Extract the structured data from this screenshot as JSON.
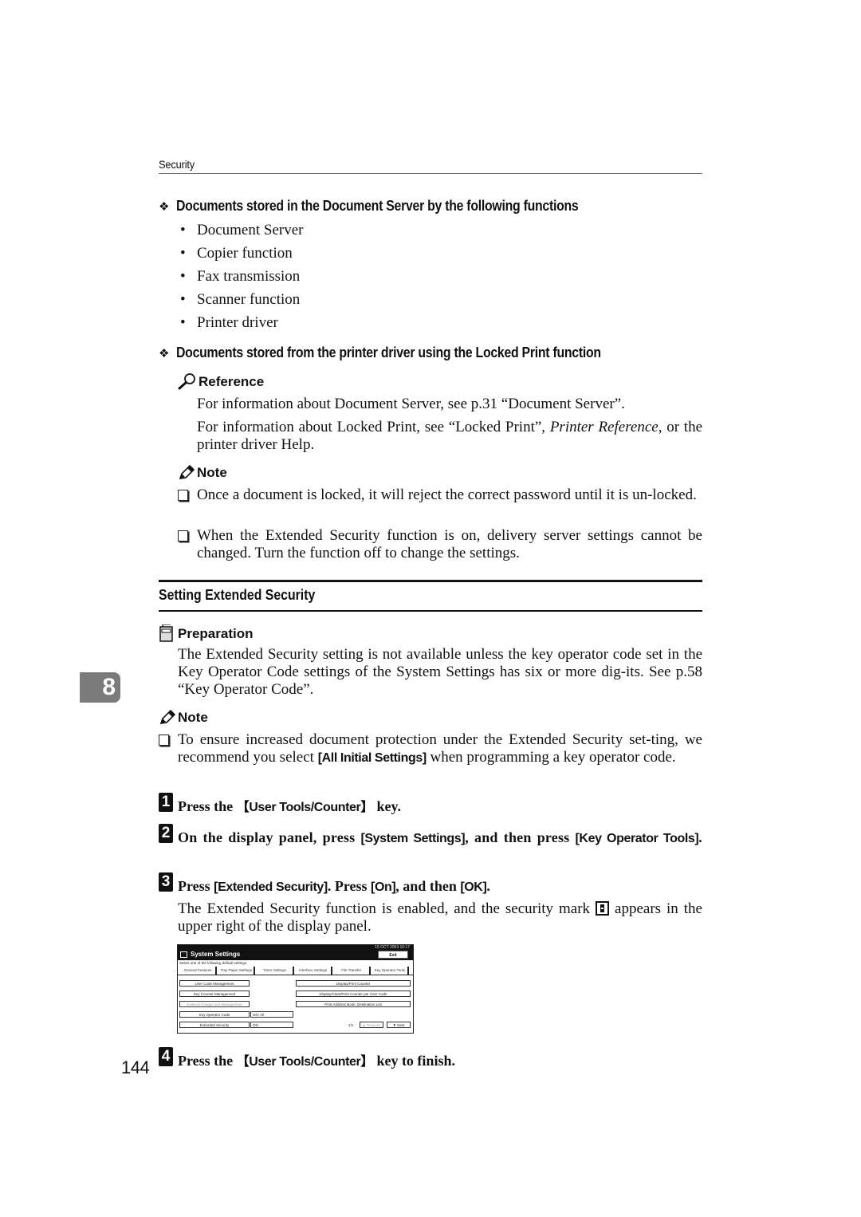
{
  "running_head": "Security",
  "section_a": {
    "heading": "Documents stored in the Document Server by the following functions",
    "items": [
      "Document Server",
      "Copier function",
      "Fax transmission",
      "Scanner function",
      "Printer driver"
    ]
  },
  "section_b": {
    "heading": "Documents stored from the printer driver using the Locked Print function"
  },
  "reference": {
    "title": "Reference",
    "line1": "For information about Document Server, see p.31 “Document Server”.",
    "line2_pre": "For information about Locked Print, see “Locked Print”, ",
    "line2_ital": "Printer Reference",
    "line2_post": ", or the printer driver Help."
  },
  "note1": {
    "title": "Note",
    "items": [
      "Once a document is locked, it will reject the correct password until it is un-locked.",
      "When the Extended Security function is on, delivery server settings cannot be changed. Turn the function off to change the settings."
    ]
  },
  "section_title": "Setting Extended Security",
  "chapter_tab": "8",
  "preparation": {
    "title": "Preparation",
    "text": "The Extended Security setting is not available unless the key operator code set in the Key Operator Code settings of the System Settings has six or more dig-its. See p.58 “Key Operator Code”."
  },
  "note2": {
    "title": "Note",
    "pre": "To ensure increased document protection under the Extended Security set-ting, we recommend you select ",
    "key": "[All Initial Settings]",
    "post": " when programming a key operator code."
  },
  "steps": [
    {
      "num": "1",
      "pre": "Press the ",
      "key": "【User Tools/Counter】",
      "post": " key."
    },
    {
      "num": "2",
      "pre": "On the display panel, press ",
      "key": "[System Settings]",
      "mid": ", and then press ",
      "key2": "[Key Operator Tools]",
      "post": "."
    },
    {
      "num": "3",
      "pre": "Press ",
      "key": "[Extended Security]",
      "mid": ". Press ",
      "key2": "[On]",
      "mid2": ", and then ",
      "key3": "[OK]",
      "post": "."
    },
    {
      "num": "4",
      "pre": "Press the ",
      "key": "【User Tools/Counter】",
      "post": " key to finish."
    }
  ],
  "step3_desc": {
    "pre": "The Extended Security function is enabled, and the security mark ",
    "post": " appears in the upper right of the display panel."
  },
  "panel": {
    "status": "15 OCT  2003 10:17",
    "title": "System Settings",
    "exit": "Exit",
    "instruction": "Select one of the following default settings.",
    "tabs": [
      "General Features",
      "Tray Paper Settings",
      "Timer Settings",
      "Interface Settings",
      "File Transfer",
      "Key Operator Tools"
    ],
    "active_tab": "Key Operator Tools",
    "left_buttons": [
      "User Code Management",
      "Key Counter Management",
      "External Charge Unit Management",
      "Key Operator Code",
      "Extended Security"
    ],
    "key_operator_code_value": "ON: All",
    "extended_security_value": "ON",
    "right_buttons": [
      "Display/Print Counter",
      "Display/Clear/Print Counter per User Code",
      "Print Address Book: Destination List"
    ],
    "page_indicator": "1/1",
    "prev": "▲ Previous",
    "next": "▼ Next"
  },
  "page_number": "144"
}
